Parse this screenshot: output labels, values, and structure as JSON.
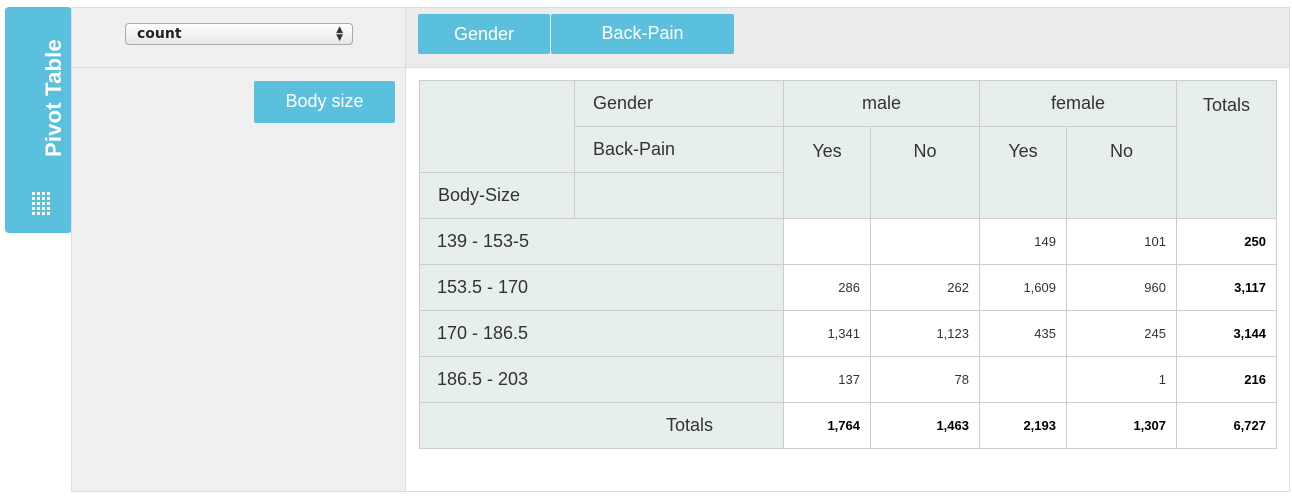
{
  "side_tab": {
    "label": "Pivot Table",
    "icon": "grip-icon"
  },
  "aggregator": {
    "selected": "count"
  },
  "col_fields": [
    "Gender",
    "Back-Pain"
  ],
  "row_fields": [
    "Body size"
  ],
  "table": {
    "col_attr_1": "Gender",
    "col_attr_2": "Back-Pain",
    "row_attr": "Body-Size",
    "male": "male",
    "female": "female",
    "totals_label": "Totals",
    "yes": "Yes",
    "no": "No",
    "rows": [
      {
        "label": "139 - 153-5",
        "cells": [
          "",
          "",
          "149",
          "101"
        ],
        "total": "250"
      },
      {
        "label": "153.5 - 170",
        "cells": [
          "286",
          "262",
          "1,609",
          "960"
        ],
        "total": "3,117"
      },
      {
        "label": "170 - 186.5",
        "cells": [
          "1,341",
          "1,123",
          "435",
          "245"
        ],
        "total": "3,144"
      },
      {
        "label": "186.5 - 203",
        "cells": [
          "137",
          "78",
          "",
          "1"
        ],
        "total": "216"
      }
    ],
    "col_totals": [
      "1,764",
      "1,463",
      "2,193",
      "1,307"
    ],
    "grand_total": "6,727"
  },
  "colors": {
    "accent": "#5bc0de",
    "header_bg": "#e6eeee",
    "panel_bg": "#f0f0f0"
  }
}
